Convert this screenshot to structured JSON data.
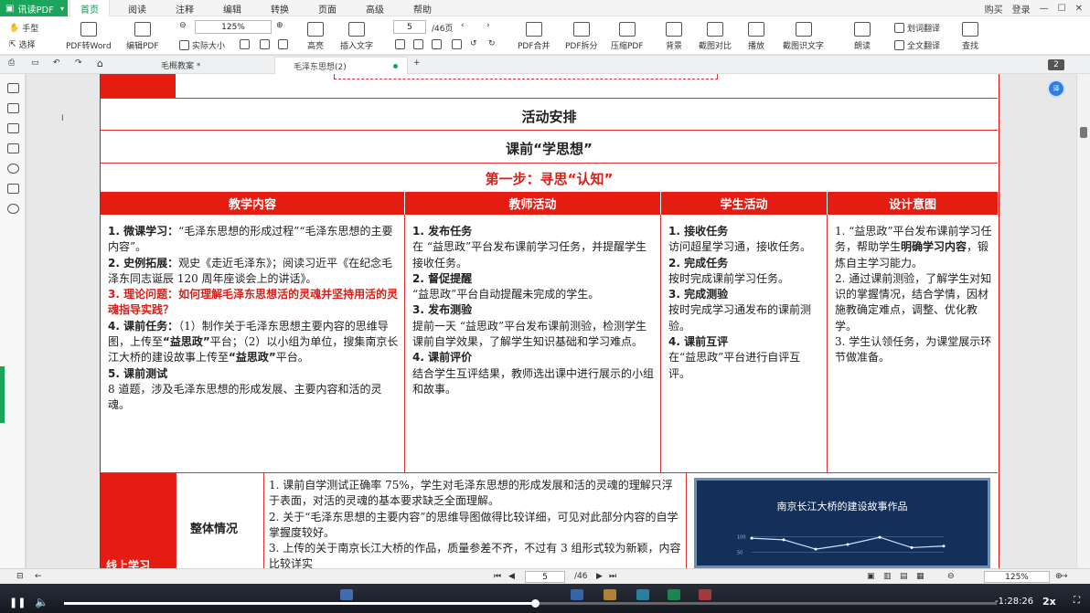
{
  "menubar": {
    "app_name": "讯读PDF",
    "tabs": [
      "首页",
      "阅读",
      "注释",
      "编辑",
      "转换",
      "页面",
      "高级",
      "帮助"
    ],
    "active_tab": "首页",
    "right": {
      "buy": "购买",
      "login": "登录"
    }
  },
  "ribbon": {
    "hand": "手型",
    "select": "选择",
    "pdf_to_word": "PDF转Word",
    "edit_pdf": "编辑PDF",
    "zoom": "125%",
    "actual_size": "实际大小",
    "highlight": "高亮",
    "insert_text": "插入文字",
    "page_current": "5",
    "page_total": "/46页",
    "merge": "PDF合并",
    "split": "PDF拆分",
    "compress": "压缩PDF",
    "background": "背景",
    "compare": "截图对比",
    "play": "播放",
    "ocr": "截图识文字",
    "read": "朗读",
    "translate": "划词翻译",
    "full_translate": "全文翻译",
    "find": "查找"
  },
  "doc_tabs": [
    {
      "label": "毛概教案 *"
    },
    {
      "label": "毛泽东思想(2)"
    }
  ],
  "document": {
    "section_title": "活动安排",
    "phase_title": "课前“学思想”",
    "step_title": "第一步：寻思“认知”",
    "columns": [
      "教学内容",
      "教师活动",
      "学生活动",
      "设计意图"
    ],
    "teaching": {
      "h1": "1. 微课学习：",
      "t1": "“毛泽东思想的形成过程”“毛泽东思想的主要内容”。",
      "h2": "2. 史例拓展：",
      "t2": "观史《走近毛泽东》；阅读习近平《在纪念毛泽东同志诞辰 120 周年座谈会上的讲话》。",
      "h3": "3. 理论问题：如何理解毛泽东思想活的灵魂并坚持用活的灵魂指导实践？",
      "h4": "4. 课前任务：",
      "t4a": "（1）制作关于毛泽东思想主要内容的思维导图，上传至",
      "t4b": "“益思政”",
      "t4c": "平台；（2）以小组为单位，搜集南京长江大桥的建设故事上传至",
      "t4d": "“益思政”",
      "t4e": "平台。",
      "h5": "5. 课前测试",
      "t5": "8 道题，涉及毛泽东思想的形成发展、主要内容和活的灵魂。"
    },
    "teacher": {
      "h1": "1. 发布任务",
      "t1": "在 “益思政”平台发布课前学习任务，并提醒学生接收任务。",
      "h2": "2. 督促提醒",
      "t2": "“益思政”平台自动提醒未完成的学生。",
      "h3": "3. 发布测验",
      "t3": "提前一天 “益思政”平台发布课前测验，检测学生课前自学效果，了解学生知识基础和学习难点。",
      "h4": "4. 课前评价",
      "t4": "结合学生互评结果，教师选出课中进行展示的小组和故事。"
    },
    "student": {
      "h1": "1. 接收任务",
      "t1": "访问超星学习通，接收任务。",
      "h2": "2. 完成任务",
      "t2": "按时完成课前学习任务。",
      "h3": "3. 完成测验",
      "t3": "按时完成学习通发布的课前测验。",
      "h4": "4. 课前互评",
      "t4": "在“益思政”平台进行自评互评。"
    },
    "intent": {
      "t1a": "1. “益思政”平台发布课前学习任务，帮助学生",
      "t1b": "明确学习内容",
      "t1c": "，锻炼自主学习能力。",
      "t2": "2. 通过课前测验，了解学生对知识的掌握情况，结合学情，因材施教确定难点，调整、优化教学。",
      "t3": "3. 学生认领任务，为课堂展示环节做准备。"
    },
    "online_label": "线上学习",
    "overall_label": "整体情况",
    "overall": {
      "p1": "1. 课前自学测试正确率 75%，学生对毛泽东思想的形成发展和活的灵魂的理解只浮于表面，对活的灵魂的基本要求缺乏全面理解。",
      "p2": "2. 关于“毛泽东思想的主要内容”的思维导图做得比较详细，可见对此部分内容的自学掌握度较好。",
      "p3": "3. 上传的关于南京长江大桥的作品，质量参差不齐，不过有 3 组形式较为新颖，内容比较详实"
    },
    "chart_card": {
      "title": "南京长江大桥的建设故事作品"
    }
  },
  "chart_data": {
    "type": "line",
    "title": "南京长江大桥的建设故事作品",
    "x": [
      1,
      2,
      3,
      4,
      5,
      6,
      7
    ],
    "series": [
      {
        "values": [
          95,
          90,
          60,
          75,
          98,
          65,
          70
        ]
      }
    ],
    "tick_labels": [
      "100",
      "50"
    ]
  },
  "status": {
    "page_current": "5",
    "page_total": "/46",
    "zoom": "125%"
  },
  "right_panel": {
    "page_badge": "2",
    "bubble": "译"
  },
  "player": {
    "time": "-1:28:26",
    "speed": "2x",
    "progress": 0.505
  }
}
